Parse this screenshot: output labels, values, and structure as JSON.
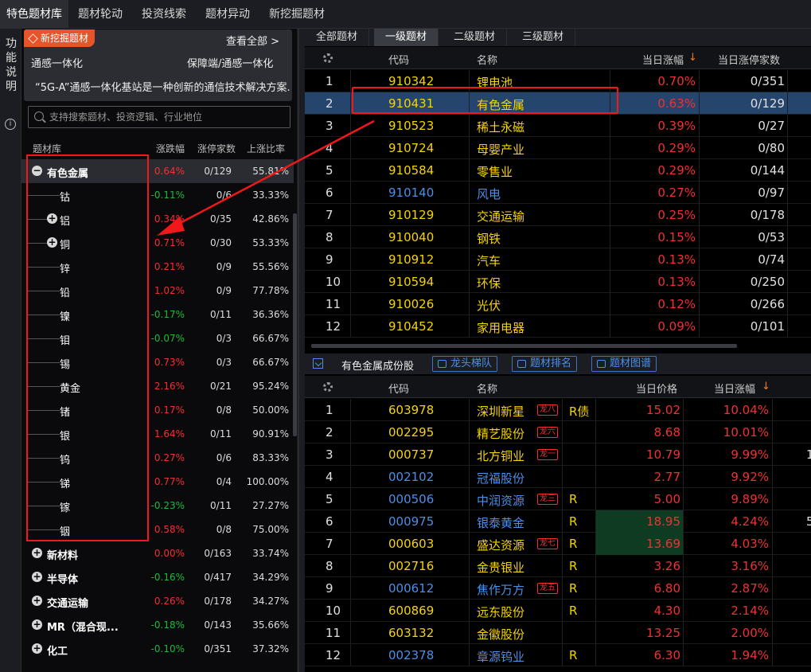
{
  "top_tabs": [
    "特色题材库",
    "题材轮动",
    "投资线索",
    "题材异动",
    "新挖掘题材"
  ],
  "side_strip": {
    "label": "功能说明",
    "info_icon": "i"
  },
  "new_card": {
    "badge": "新挖掘题材",
    "view_all": "查看全部 >",
    "line2_left": "通感一体化",
    "line2_right": "保障端/通感一体化",
    "line3": "“5G-A”通感一体化基站是一种创新的通信技术解决方案..."
  },
  "search": {
    "placeholder": "支持搜索题材、投资逻辑、行业地位"
  },
  "left_header": {
    "col1": "题材库",
    "col2": "涨跌幅",
    "col3": "涨停家数",
    "col4": "上涨比率"
  },
  "tree": [
    {
      "name": "有色金属",
      "pct": "0.64%",
      "lim": "0/129",
      "ratio": "55.81%",
      "level": 1,
      "icon": "−",
      "color": "red"
    },
    {
      "name": "钴",
      "pct": "-0.11%",
      "lim": "0/6",
      "ratio": "33.33%",
      "level": 2,
      "icon": "",
      "color": "green"
    },
    {
      "name": "铝",
      "pct": "0.34%",
      "lim": "0/35",
      "ratio": "42.86%",
      "level": 2,
      "icon": "+",
      "color": "red"
    },
    {
      "name": "铜",
      "pct": "0.71%",
      "lim": "0/30",
      "ratio": "53.33%",
      "level": 2,
      "icon": "+",
      "color": "red"
    },
    {
      "name": "锌",
      "pct": "0.21%",
      "lim": "0/9",
      "ratio": "55.56%",
      "level": 2,
      "icon": "",
      "color": "red"
    },
    {
      "name": "铅",
      "pct": "1.02%",
      "lim": "0/9",
      "ratio": "77.78%",
      "level": 2,
      "icon": "",
      "color": "red"
    },
    {
      "name": "镍",
      "pct": "-0.17%",
      "lim": "0/11",
      "ratio": "36.36%",
      "level": 2,
      "icon": "",
      "color": "green"
    },
    {
      "name": "钼",
      "pct": "-0.07%",
      "lim": "0/3",
      "ratio": "66.67%",
      "level": 2,
      "icon": "",
      "color": "green"
    },
    {
      "name": "锡",
      "pct": "0.73%",
      "lim": "0/3",
      "ratio": "66.67%",
      "level": 2,
      "icon": "",
      "color": "red"
    },
    {
      "name": "黄金",
      "pct": "2.16%",
      "lim": "0/21",
      "ratio": "95.24%",
      "level": 2,
      "icon": "",
      "color": "red"
    },
    {
      "name": "锗",
      "pct": "0.17%",
      "lim": "0/8",
      "ratio": "50.00%",
      "level": 2,
      "icon": "",
      "color": "red"
    },
    {
      "name": "银",
      "pct": "1.64%",
      "lim": "0/11",
      "ratio": "90.91%",
      "level": 2,
      "icon": "",
      "color": "red"
    },
    {
      "name": "钨",
      "pct": "0.27%",
      "lim": "0/6",
      "ratio": "83.33%",
      "level": 2,
      "icon": "",
      "color": "red"
    },
    {
      "name": "锑",
      "pct": "0.77%",
      "lim": "0/4",
      "ratio": "100.00%",
      "level": 2,
      "icon": "",
      "color": "red"
    },
    {
      "name": "镓",
      "pct": "-0.23%",
      "lim": "0/11",
      "ratio": "27.27%",
      "level": 2,
      "icon": "",
      "color": "green"
    },
    {
      "name": "铟",
      "pct": "0.58%",
      "lim": "0/8",
      "ratio": "75.00%",
      "level": 2,
      "icon": "",
      "color": "red"
    },
    {
      "name": "新材料",
      "pct": "0.00%",
      "lim": "0/163",
      "ratio": "33.74%",
      "level": 1,
      "icon": "+",
      "color": "red"
    },
    {
      "name": "半导体",
      "pct": "-0.16%",
      "lim": "0/417",
      "ratio": "34.29%",
      "level": 1,
      "icon": "+",
      "color": "green"
    },
    {
      "name": "交通运输",
      "pct": "0.26%",
      "lim": "0/178",
      "ratio": "34.27%",
      "level": 1,
      "icon": "+",
      "color": "red"
    },
    {
      "name": "MR（混合现...",
      "pct": "-0.18%",
      "lim": "0/143",
      "ratio": "35.66%",
      "level": 1,
      "icon": "+",
      "color": "green"
    },
    {
      "name": "化工",
      "pct": "-0.10%",
      "lim": "0/351",
      "ratio": "37.32%",
      "level": 1,
      "icon": "+",
      "color": "green"
    }
  ],
  "sub_tabs": [
    "全部题材",
    "一级题材",
    "二级题材",
    "三级题材"
  ],
  "top_grid": {
    "headers": {
      "code": "代码",
      "name": "名称",
      "chg": "当日涨幅",
      "sort": "↓",
      "lim": "当日涨停家数"
    },
    "rows": [
      {
        "n": "1",
        "code": "910342",
        "name": "锂电池",
        "chg": "0.70%",
        "lim": "0/351",
        "blue": false
      },
      {
        "n": "2",
        "code": "910431",
        "name": "有色金属",
        "chg": "0.63%",
        "lim": "0/129",
        "blue": false
      },
      {
        "n": "3",
        "code": "910523",
        "name": "稀土永磁",
        "chg": "0.39%",
        "lim": "0/27",
        "blue": false
      },
      {
        "n": "4",
        "code": "910724",
        "name": "母婴产业",
        "chg": "0.29%",
        "lim": "0/80",
        "blue": false
      },
      {
        "n": "5",
        "code": "910584",
        "name": "零售业",
        "chg": "0.29%",
        "lim": "0/144",
        "blue": false
      },
      {
        "n": "6",
        "code": "910140",
        "name": "风电",
        "chg": "0.27%",
        "lim": "0/97",
        "blue": true
      },
      {
        "n": "7",
        "code": "910129",
        "name": "交通运输",
        "chg": "0.25%",
        "lim": "0/178",
        "blue": false
      },
      {
        "n": "8",
        "code": "910040",
        "name": "钢铁",
        "chg": "0.15%",
        "lim": "0/53",
        "blue": false
      },
      {
        "n": "9",
        "code": "910912",
        "name": "汽车",
        "chg": "0.13%",
        "lim": "0/74",
        "blue": false
      },
      {
        "n": "10",
        "code": "910594",
        "name": "环保",
        "chg": "0.13%",
        "lim": "0/250",
        "blue": false
      },
      {
        "n": "11",
        "code": "910026",
        "name": "光伏",
        "chg": "0.12%",
        "lim": "0/266",
        "blue": false
      },
      {
        "n": "12",
        "code": "910452",
        "name": "家用电器",
        "chg": "0.09%",
        "lim": "0/101",
        "blue": false
      }
    ]
  },
  "bottom_toolbar": {
    "title": "有色金属成份股",
    "btn1": "龙头梯队",
    "btn2": "题材排名",
    "btn3": "题材图谱"
  },
  "bottom_grid": {
    "headers": {
      "code": "代码",
      "name": "名称",
      "price": "当日价格",
      "chg": "当日涨幅",
      "sort": "↓"
    },
    "rows": [
      {
        "n": "1",
        "code": "603978",
        "name": "深圳新星",
        "tag": "龙八",
        "flag": "R债",
        "price": "15.02",
        "chg": "10.04%",
        "blue": false,
        "extra": ""
      },
      {
        "n": "2",
        "code": "002295",
        "name": "精艺股份",
        "tag": "龙六",
        "flag": "",
        "price": "8.68",
        "chg": "10.01%",
        "blue": false,
        "extra": ""
      },
      {
        "n": "3",
        "code": "000737",
        "name": "北方铜业",
        "tag": "龙一",
        "flag": "",
        "price": "10.79",
        "chg": "9.99%",
        "blue": false,
        "extra": "1"
      },
      {
        "n": "4",
        "code": "002102",
        "name": "冠福股份",
        "tag": "",
        "flag": "",
        "price": "2.77",
        "chg": "9.92%",
        "blue": true,
        "extra": ""
      },
      {
        "n": "5",
        "code": "000506",
        "name": "中润资源",
        "tag": "龙三",
        "flag": "R",
        "price": "5.00",
        "chg": "9.89%",
        "blue": true,
        "extra": ""
      },
      {
        "n": "6",
        "code": "000975",
        "name": "银泰黄金",
        "tag": "",
        "flag": "R",
        "price": "18.95",
        "chg": "4.24%",
        "blue": true,
        "extra": "5"
      },
      {
        "n": "7",
        "code": "000603",
        "name": "盛达资源",
        "tag": "龙七",
        "flag": "R",
        "price": "13.69",
        "chg": "4.03%",
        "blue": false,
        "extra": ""
      },
      {
        "n": "8",
        "code": "002716",
        "name": "金贵银业",
        "tag": "",
        "flag": "R",
        "price": "3.26",
        "chg": "3.16%",
        "blue": false,
        "extra": ""
      },
      {
        "n": "9",
        "code": "000612",
        "name": "焦作万方",
        "tag": "龙五",
        "flag": "R",
        "price": "6.80",
        "chg": "2.87%",
        "blue": true,
        "extra": ""
      },
      {
        "n": "10",
        "code": "600869",
        "name": "远东股份",
        "tag": "",
        "flag": "R",
        "price": "4.30",
        "chg": "2.14%",
        "blue": false,
        "extra": ""
      },
      {
        "n": "11",
        "code": "603132",
        "name": "金徽股份",
        "tag": "",
        "flag": "",
        "price": "13.25",
        "chg": "2.00%",
        "blue": false,
        "extra": ""
      },
      {
        "n": "12",
        "code": "002378",
        "name": "章源钨业",
        "tag": "",
        "flag": "R",
        "price": "6.30",
        "chg": "1.94%",
        "blue": true,
        "extra": ""
      }
    ]
  },
  "colors": {
    "up": "#f23030",
    "down": "#1fb83a",
    "code": "#f5d400",
    "blue": "#4b8fe8",
    "annotation": "#f01818"
  }
}
